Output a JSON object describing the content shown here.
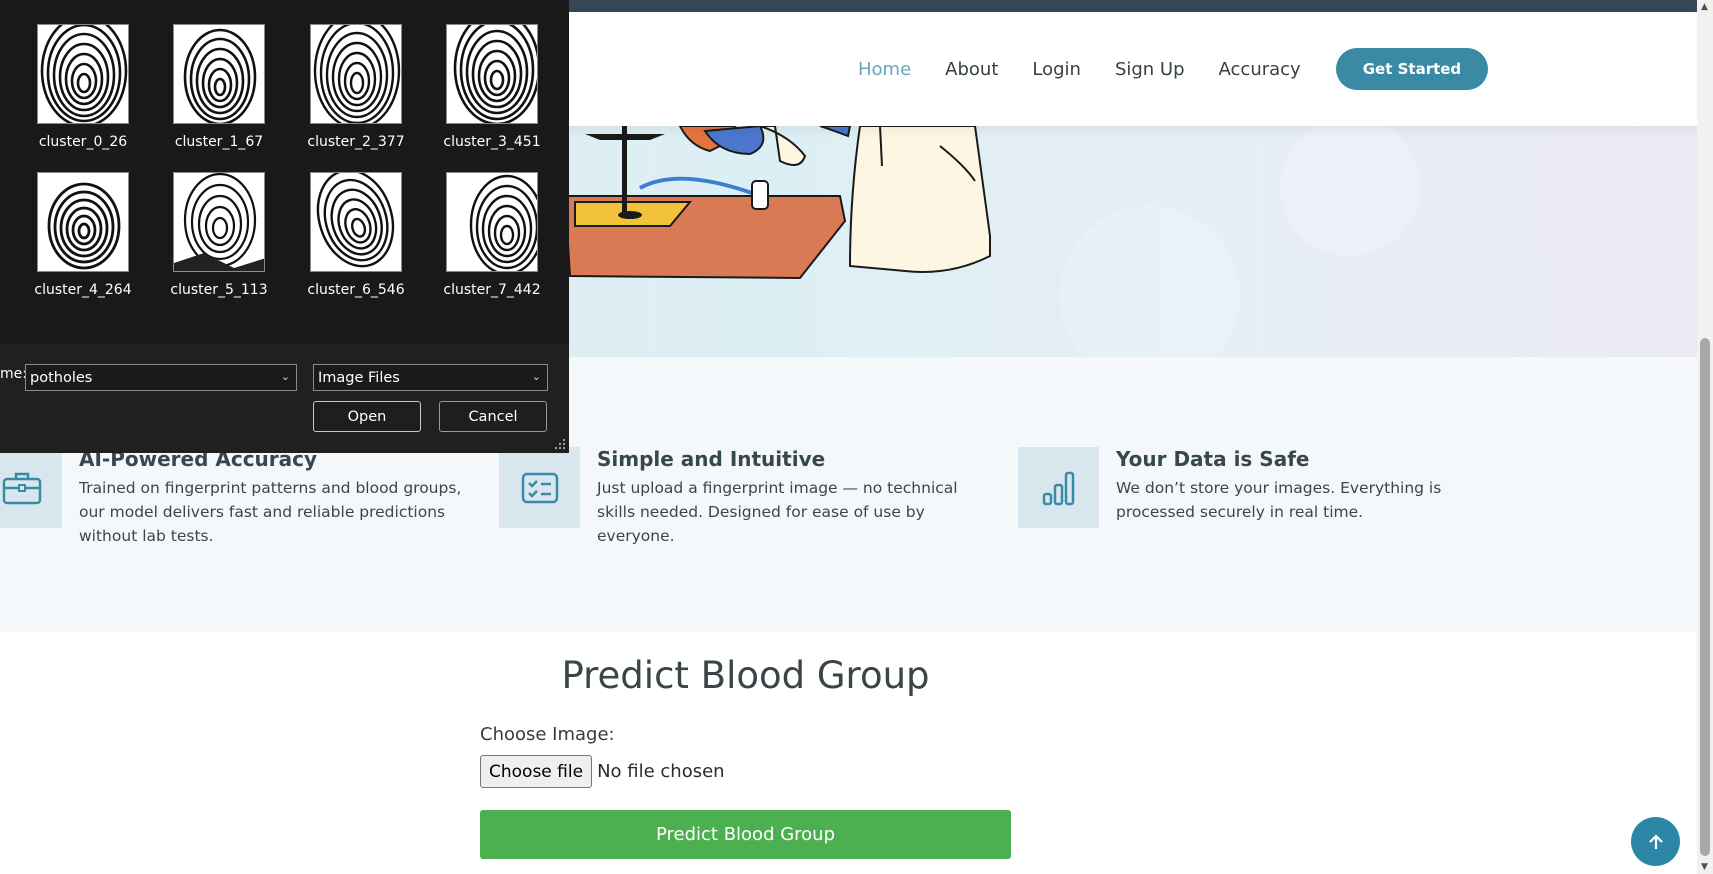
{
  "nav": {
    "items": [
      "Home",
      "About",
      "Login",
      "Sign Up",
      "Accuracy"
    ],
    "cta": "Get Started",
    "active": "Home"
  },
  "features": [
    {
      "icon": "briefcase-icon",
      "title": "AI-Powered Accuracy",
      "text": "Trained on fingerprint patterns and blood groups, our model delivers fast and reliable predictions without lab tests."
    },
    {
      "icon": "checklist-icon",
      "title": "Simple and Intuitive",
      "text": "Just upload a fingerprint image — no technical skills needed. Designed for ease of use by everyone."
    },
    {
      "icon": "bar-chart-icon",
      "title": "Your Data is Safe",
      "text": "We don’t store your images. Everything is processed securely in real time."
    }
  ],
  "predict": {
    "title": "Predict Blood Group",
    "choose_label": "Choose Image:",
    "file_button": "Choose file",
    "file_status": "No file chosen",
    "submit": "Predict Blood Group"
  },
  "dialog": {
    "files": [
      "cluster_0_26",
      "cluster_1_67",
      "cluster_2_377",
      "cluster_3_451",
      "cluster_4_264",
      "cluster_5_113",
      "cluster_6_546",
      "cluster_7_442"
    ],
    "filename_label": "me:",
    "filename_value": "potholes",
    "filetype": "Image Files",
    "open": "Open",
    "cancel": "Cancel"
  },
  "colors": {
    "accent": "#3a8aa5",
    "nav_active": "#6aa5bf",
    "predict_button": "#4caf50",
    "topstrip": "#37475a"
  }
}
